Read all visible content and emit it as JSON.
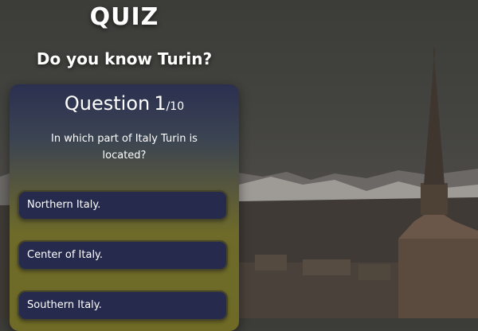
{
  "header": {
    "title": "QUIZ",
    "subtitle": "Do you know Turin?"
  },
  "question": {
    "label": "Question",
    "number": "1",
    "total": "/10",
    "text": "In which part of Italy Turin is located?"
  },
  "answers": [
    {
      "label": "Northern Italy."
    },
    {
      "label": "Center of Italy."
    },
    {
      "label": "Southern Italy."
    }
  ],
  "colors": {
    "card_top": "#2b3050",
    "card_bottom": "#6f6a26",
    "answer_bg": "#262a4c",
    "text": "#ffffff"
  }
}
